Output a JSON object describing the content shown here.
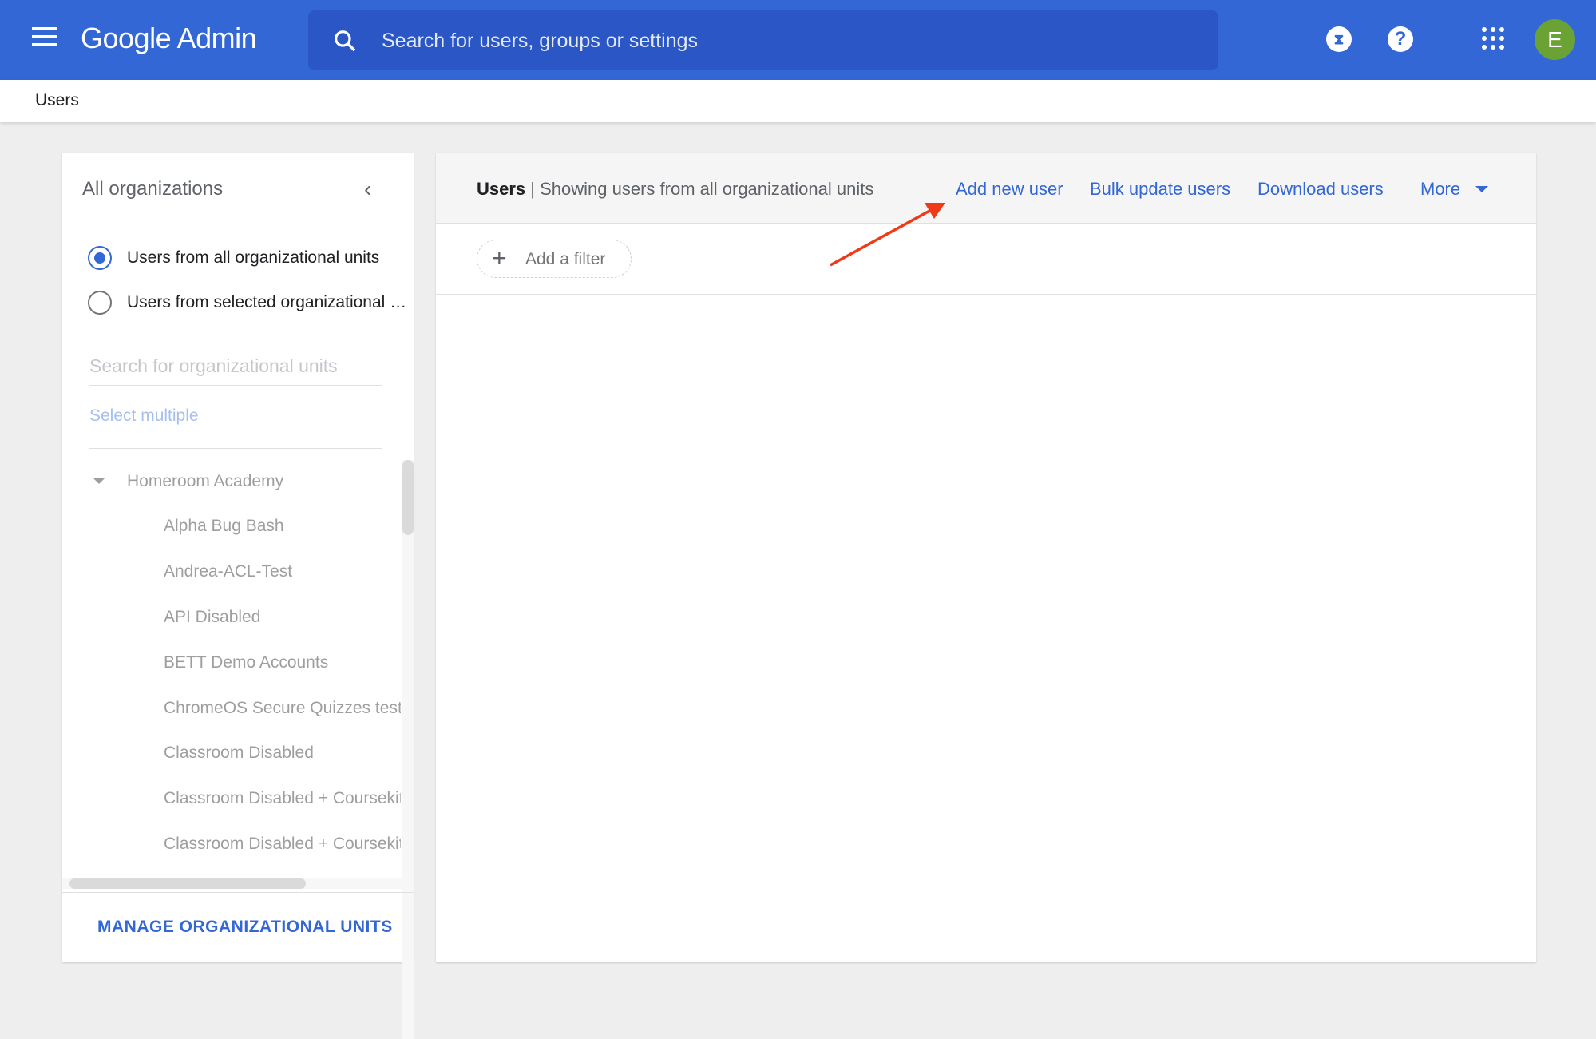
{
  "header": {
    "app_title": "Google Admin",
    "search_placeholder": "Search for users, groups or settings",
    "timer_icon": "hourglass",
    "help_icon": "?",
    "avatar_letter": "E",
    "colors": {
      "bar": "#3367d6",
      "search": "#2a56c6",
      "avatar": "#6aa334"
    }
  },
  "breadcrumb": "Users",
  "sidebar": {
    "title": "All organizations",
    "radio_all": "Users from all organizational units",
    "radio_selected": "Users from selected organizational units",
    "search_placeholder": "Search for organizational units",
    "select_multiple": "Select multiple",
    "root": "Homeroom Academy",
    "children": [
      "Alpha Bug Bash",
      "Andrea-ACL-Test",
      "API Disabled",
      "BETT Demo Accounts",
      "ChromeOS Secure Quizzes test",
      "Classroom Disabled",
      "Classroom Disabled + Coursekit",
      "Classroom Disabled + Coursekit"
    ],
    "manage": "MANAGE ORGANIZATIONAL UNITS"
  },
  "main": {
    "title": "Users",
    "subtitle": "| Showing users from all organizational units",
    "actions": [
      "Add new user",
      "Bulk update users",
      "Download users",
      "More"
    ],
    "add_filter": "Add a filter"
  },
  "annotation": {
    "arrow_color": "#f03a17"
  }
}
